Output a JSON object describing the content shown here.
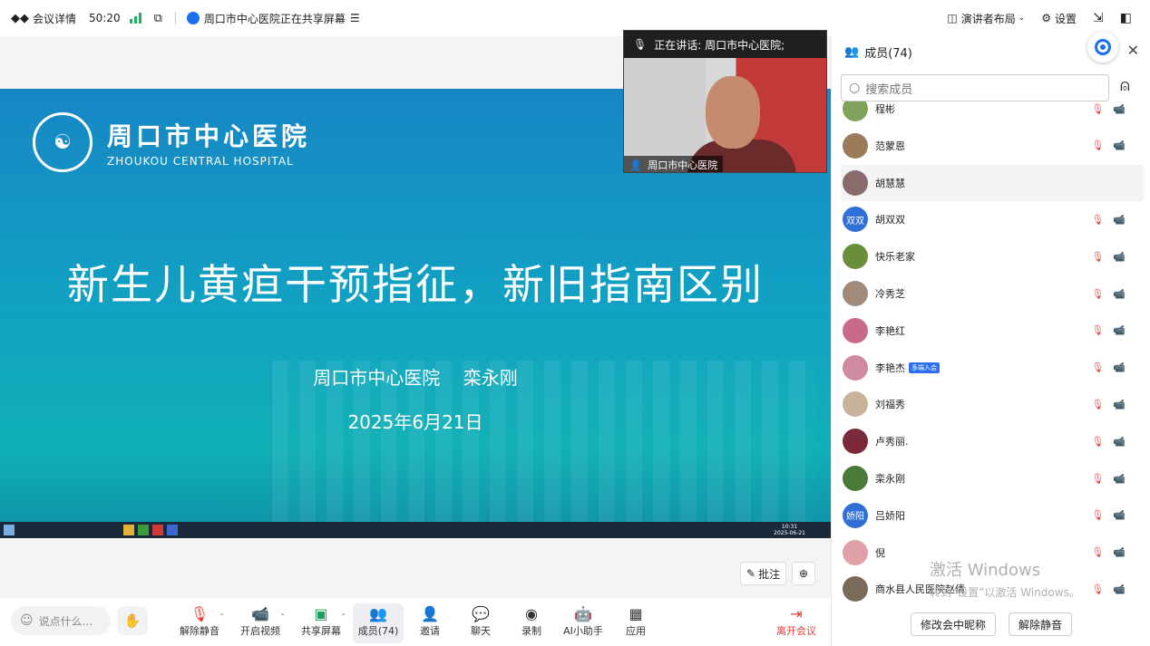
{
  "topbar": {
    "meeting_details": "会议详情",
    "timer": "50:20",
    "sharing_status": "周口市中心医院正在共享屏幕",
    "layout": "演讲者布局",
    "settings": "设置"
  },
  "slide": {
    "hospital_cn": "周口市中心医院",
    "hospital_en": "ZHOUKOU CENTRAL HOSPITAL",
    "title": "新生儿黄疸干预指征，新旧指南区别",
    "presenter": "周口市中心医院    栾永刚",
    "date": "2025年6月21日",
    "taskbar_time": "10:31",
    "taskbar_date": "2025-06-21"
  },
  "video": {
    "speaking": "正在讲话:  周口市中心医院;",
    "name": "周口市中心医院"
  },
  "annotation": {
    "annotate": "批注"
  },
  "bottom": {
    "say_placeholder": "说点什么...",
    "unmute": "解除静音",
    "start_video": "开启视频",
    "share_screen": "共享屏幕",
    "members": "成员(74)",
    "invite": "邀请",
    "chat": "聊天",
    "record": "录制",
    "ai_assistant": "AI小助手",
    "apps": "应用",
    "leave": "离开会议"
  },
  "panel": {
    "title": "成员(74)",
    "search_placeholder": "搜索成员",
    "members": [
      {
        "name": "程彬",
        "avatar_color": "#7fa35a",
        "avatar_text": ""
      },
      {
        "name": "范蒙恩",
        "avatar_color": "#9a7b5a",
        "avatar_text": ""
      },
      {
        "name": "胡慧慧",
        "avatar_color": "#8a6b6b",
        "avatar_text": ""
      },
      {
        "name": "胡双双",
        "avatar_color": "#2f6fd6",
        "avatar_text": "双双"
      },
      {
        "name": "快乐老家",
        "avatar_color": "#6a8f3a",
        "avatar_text": ""
      },
      {
        "name": "冷秀芝",
        "avatar_color": "#a08b7a",
        "avatar_text": ""
      },
      {
        "name": "李艳红",
        "avatar_color": "#c96a8a",
        "avatar_text": ""
      },
      {
        "name": "李艳杰",
        "avatar_color": "#d08aa0",
        "avatar_text": "",
        "tag": "多端入会"
      },
      {
        "name": "刘福秀",
        "avatar_color": "#c8b49a",
        "avatar_text": ""
      },
      {
        "name": "卢秀丽.",
        "avatar_color": "#7a2a3a",
        "avatar_text": ""
      },
      {
        "name": "栾永刚",
        "avatar_color": "#4a7a3a",
        "avatar_text": ""
      },
      {
        "name": "吕娇阳",
        "avatar_color": "#2f6fd6",
        "avatar_text": "娇阳"
      },
      {
        "name": "倪",
        "avatar_color": "#e0a0a8",
        "avatar_text": ""
      },
      {
        "name": "商水县人民医院赵倩",
        "avatar_color": "#7a6a5a",
        "avatar_text": ""
      }
    ],
    "watermark_line1": "激活 Windows",
    "watermark_line2": "转到“设置”以激活 Windows。",
    "edit_nickname": "修改会中昵称",
    "unmute_all": "解除静音"
  }
}
